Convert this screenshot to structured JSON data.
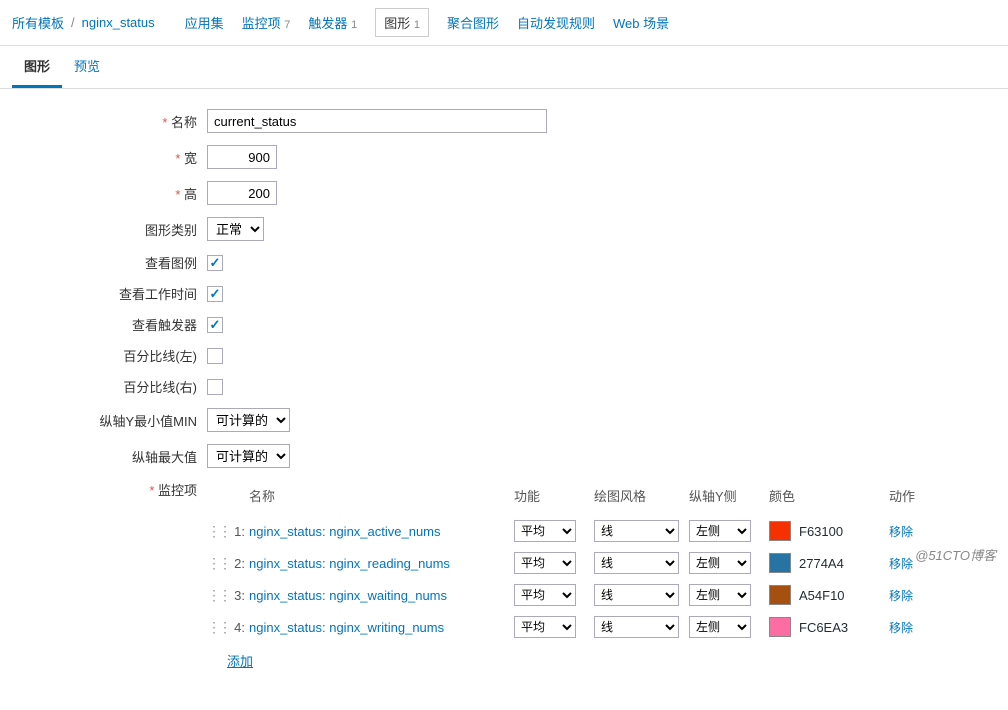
{
  "breadcrumb": {
    "root": "所有模板",
    "current": "nginx_status"
  },
  "nav": [
    {
      "label": "应用集",
      "count": ""
    },
    {
      "label": "监控项",
      "count": "7"
    },
    {
      "label": "触发器",
      "count": "1"
    },
    {
      "label": "图形",
      "count": "1",
      "active": true
    },
    {
      "label": "聚合图形",
      "count": ""
    },
    {
      "label": "自动发现规则",
      "count": ""
    },
    {
      "label": "Web 场景",
      "count": ""
    }
  ],
  "tabs": [
    {
      "label": "图形",
      "active": true
    },
    {
      "label": "预览",
      "active": false
    }
  ],
  "form": {
    "name_label": "名称",
    "name_value": "current_status",
    "width_label": "宽",
    "width_value": "900",
    "height_label": "高",
    "height_value": "200",
    "type_label": "图形类别",
    "type_value": "正常",
    "legend_label": "查看图例",
    "legend_checked": true,
    "worktime_label": "查看工作时间",
    "worktime_checked": true,
    "triggers_label": "查看触发器",
    "triggers_checked": true,
    "percent_left_label": "百分比线(左)",
    "percent_left_checked": false,
    "percent_right_label": "百分比线(右)",
    "percent_right_checked": false,
    "ymin_label": "纵轴Y最小值MIN",
    "ymin_value": "可计算的",
    "ymax_label": "纵轴最大值",
    "ymax_value": "可计算的",
    "items_label": "监控项"
  },
  "items_header": {
    "name": "名称",
    "func": "功能",
    "style": "绘图风格",
    "yaxis": "纵轴Y侧",
    "color": "颜色",
    "action": "动作"
  },
  "items": [
    {
      "n": "1:",
      "name": "nginx_status: nginx_active_nums",
      "func": "平均",
      "style": "线",
      "yaxis": "左侧",
      "color": "F63100",
      "swatch": "#F63100"
    },
    {
      "n": "2:",
      "name": "nginx_status: nginx_reading_nums",
      "func": "平均",
      "style": "线",
      "yaxis": "左侧",
      "color": "2774A4",
      "swatch": "#2774A4"
    },
    {
      "n": "3:",
      "name": "nginx_status: nginx_waiting_nums",
      "func": "平均",
      "style": "线",
      "yaxis": "左侧",
      "color": "A54F10",
      "swatch": "#A54F10"
    },
    {
      "n": "4:",
      "name": "nginx_status: nginx_writing_nums",
      "func": "平均",
      "style": "线",
      "yaxis": "左侧",
      "color": "FC6EA3",
      "swatch": "#FC6EA3"
    }
  ],
  "remove_label": "移除",
  "add_label": "添加",
  "watermark": "@51CTO博客"
}
